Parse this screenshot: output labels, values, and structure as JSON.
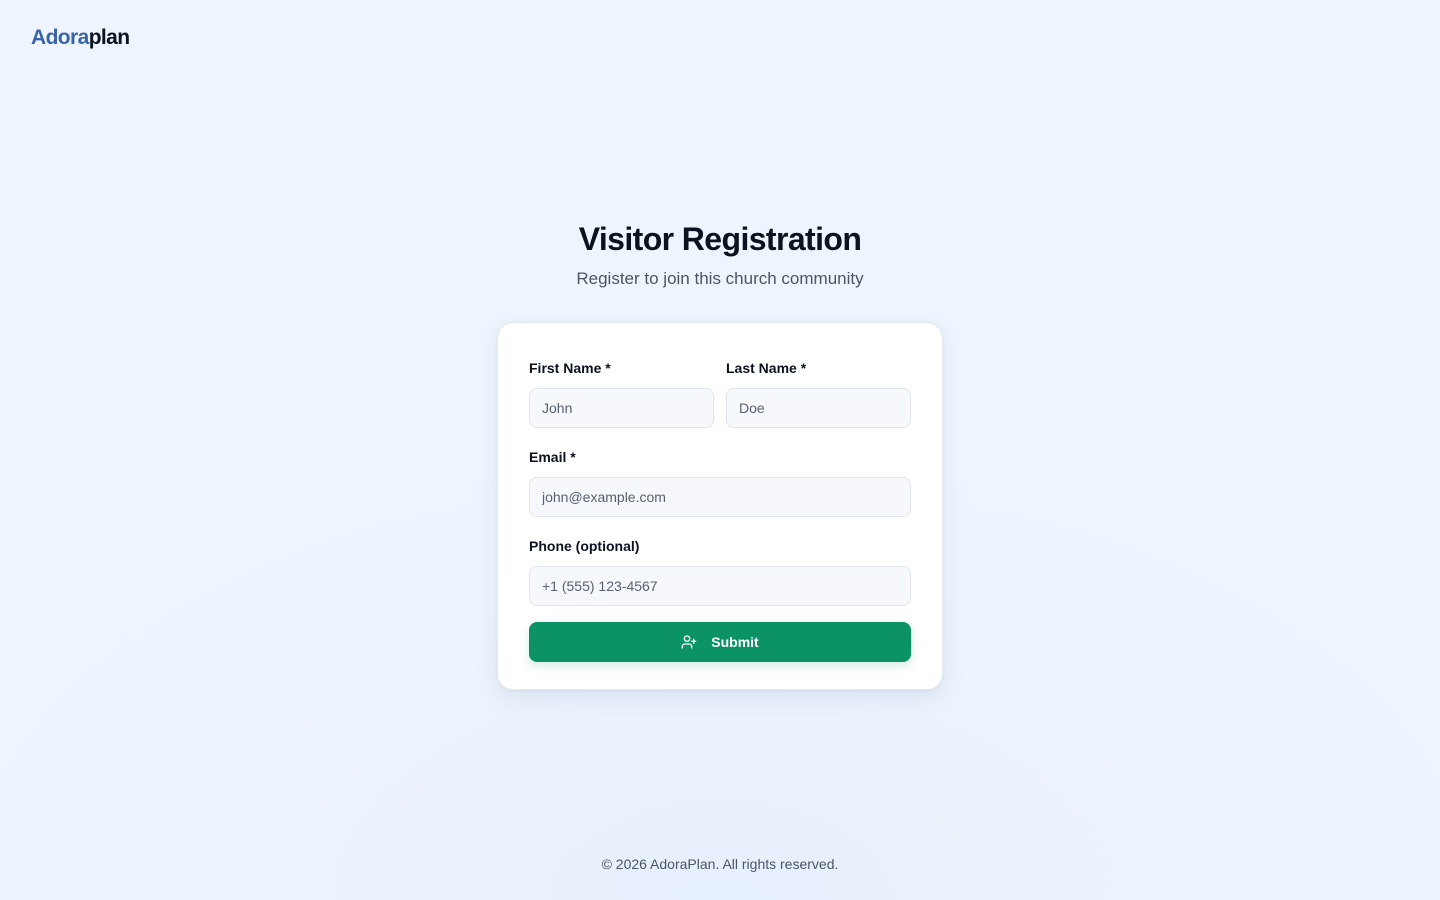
{
  "brand": {
    "part1": "Adora",
    "part2": "plan",
    "accent_color": "#3a63a8"
  },
  "header": {
    "title": "Visitor Registration",
    "subtitle": "Register to join this church community"
  },
  "form": {
    "first_name": {
      "label": "First Name *",
      "placeholder": "John",
      "value": ""
    },
    "last_name": {
      "label": "Last Name *",
      "placeholder": "Doe",
      "value": ""
    },
    "email": {
      "label": "Email *",
      "placeholder": "john@example.com",
      "value": ""
    },
    "phone": {
      "label": "Phone (optional)",
      "placeholder": "+1 (555) 123-4567",
      "value": ""
    },
    "submit": {
      "label": "Submit",
      "icon": "user-plus-icon",
      "color": "#0b9366"
    }
  },
  "footer": {
    "text": "© 2026 AdoraPlan. All rights reserved."
  }
}
